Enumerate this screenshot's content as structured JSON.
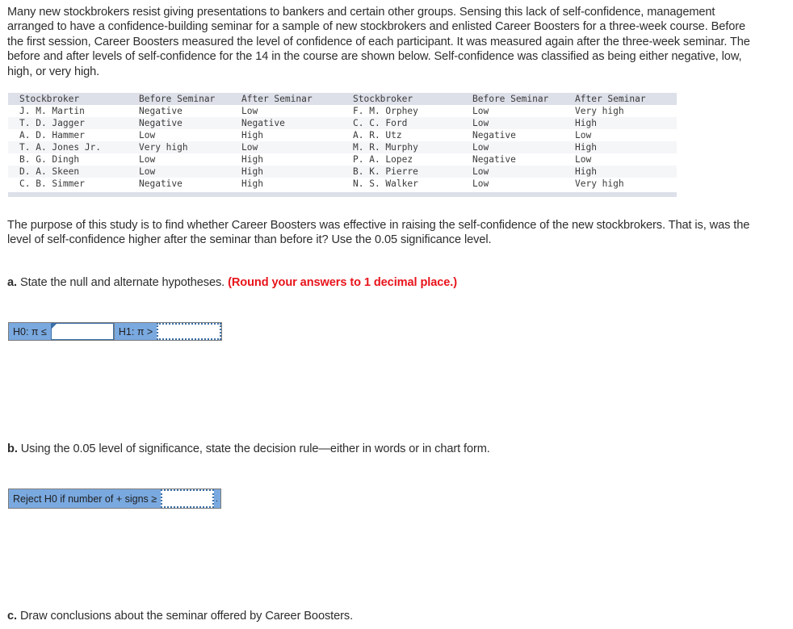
{
  "intro": "Many new stockbrokers resist giving presentations to bankers and certain other groups. Sensing this lack of self-confidence, management arranged to have a confidence-building seminar for a sample of new stockbrokers and enlisted Career Boosters for a three-week course. Before the first session, Career Boosters measured the level of confidence of each participant. It was measured again after the three-week seminar. The before and after levels of self-confidence for the 14 in the course are shown below. Self-confidence was classified as being either negative, low, high, or very high.",
  "table": {
    "headers": [
      "Stockbroker",
      "Before Seminar",
      "After Seminar",
      "Stockbroker",
      "Before Seminar",
      "After Seminar"
    ],
    "rows": [
      [
        "J. M. Martin",
        "Negative",
        "Low",
        "F. M. Orphey",
        "Low",
        "Very high"
      ],
      [
        "T. D. Jagger",
        "Negative",
        "Negative",
        "C. C. Ford",
        "Low",
        "High"
      ],
      [
        "A. D. Hammer",
        "Low",
        "High",
        "A. R. Utz",
        "Negative",
        "Low"
      ],
      [
        "T. A. Jones Jr.",
        "Very high",
        "Low",
        "M. R. Murphy",
        "Low",
        "High"
      ],
      [
        "B. G. Dingh",
        "Low",
        "High",
        "P. A. Lopez",
        "Negative",
        "Low"
      ],
      [
        "D. A. Skeen",
        "Low",
        "High",
        "B. K. Pierre",
        "Low",
        "High"
      ],
      [
        "C. B. Simmer",
        "Negative",
        "High",
        "N. S. Walker",
        "Low",
        "Very high"
      ]
    ]
  },
  "purpose": "The purpose of this study is to find whether Career Boosters was effective in raising the self-confidence of the new stockbrokers. That is, was the level of self-confidence higher after the seminar than before it? Use the 0.05 significance level.",
  "part_a": {
    "label": "a.",
    "text": " State the null and alternate hypotheses. ",
    "instruction": "(Round your answers to 1 decimal place.)",
    "h0_label": "H0: π ≤",
    "h0_value": "",
    "h1_label": "H1: π >",
    "h1_value": ""
  },
  "part_b": {
    "label": "b.",
    "text": " Using the 0.05 level of significance, state the decision rule—either in words or in chart form.",
    "rule_label": "Reject H0 if number of + signs ≥",
    "rule_value": "",
    "rule_suffix": "."
  },
  "part_c": {
    "label": "c.",
    "text": " Draw conclusions about the seminar offered by Career Boosters."
  }
}
